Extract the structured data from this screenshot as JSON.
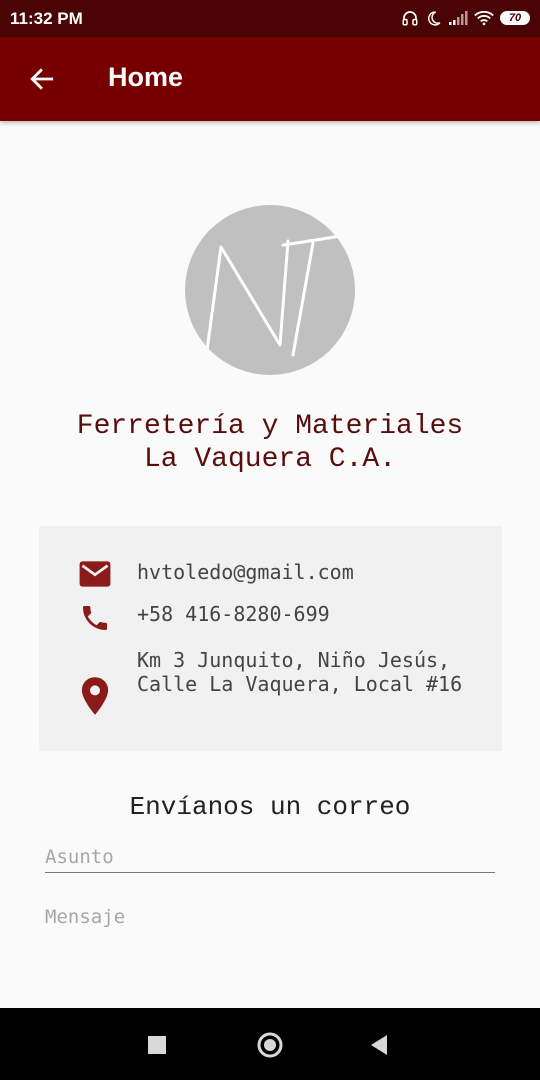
{
  "status_bar": {
    "time": "11:32 PM",
    "battery_level": "70",
    "icons": [
      "headphones-icon",
      "moon-icon",
      "signal-icon",
      "wifi-icon",
      "battery-icon"
    ]
  },
  "app_bar": {
    "title": "Home",
    "back_icon": "arrow-left-icon"
  },
  "logo": {
    "text": "NT"
  },
  "company": {
    "name_line1": "Ferretería y Materiales",
    "name_line2": "La Vaquera C.A."
  },
  "contact": {
    "email": "hvtoledo@gmail.com",
    "phone": "+58 416-8280-699",
    "address": "Km 3 Junquito, Niño Jesús, Calle La Vaquera, Local #16"
  },
  "form": {
    "title": "Envíanos un correo",
    "subject_placeholder": "Asunto",
    "message_placeholder": "Mensaje"
  },
  "colors": {
    "status_bar": "#4a0404",
    "app_bar": "#760000",
    "accent": "#8b1a1a",
    "text_brand": "#5a0d0d"
  }
}
